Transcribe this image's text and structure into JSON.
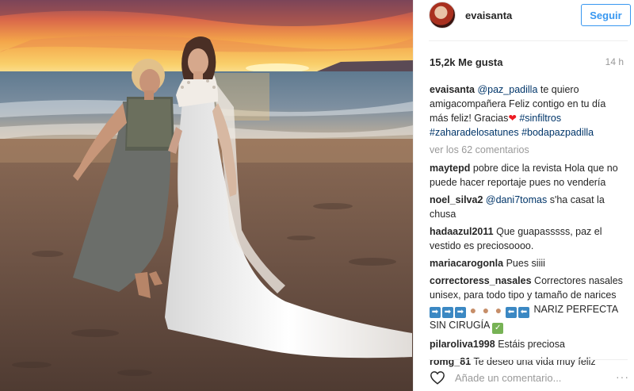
{
  "post": {
    "username": "evaisanta",
    "follow_label": "Seguir",
    "likes": "15,2k Me gusta",
    "time": "14 h",
    "caption": {
      "user": "evaisanta",
      "mention": "@paz_padilla",
      "text1": " te quiero amigacompañera Feliz contigo en tu día más feliz! Gracias",
      "tag1": "#sinfiltros",
      "tag2": "#zaharadelosatunes",
      "tag3": "#bodapazpadilla"
    },
    "view_more": "ver los 62 comentarios",
    "comments": [
      {
        "user": "maytepd",
        "text": "pobre dice la revista Hola que no puede hacer reportaje pues no vendería"
      },
      {
        "user": "noel_silva2",
        "mention": "@dani7tomas",
        "text": " s'ha casat la chusa"
      },
      {
        "user": "hadaazul2011",
        "text": "Que guapasssss, paz el vestido es preciosoooo."
      },
      {
        "user": "mariacarogonla",
        "text": "Pues siiii"
      },
      {
        "user": "correctoress_nasales",
        "text": "Correctores nasales unisex, para todo tipo y tamaño de narices",
        "text2": "NARIZ PERFECTA SIN CIRUGÍA"
      },
      {
        "user": "pilaroliva1998",
        "text": "Estáis preciosa"
      },
      {
        "user": "romg_81",
        "text": "Te deseo una vida muy feliz"
      }
    ],
    "comment_placeholder": "Añade un comentario...",
    "more_options": "···"
  },
  "icons": [
    "heart-icon",
    "more-options-icon",
    "avatar"
  ],
  "colors": {
    "accent": "#3897f0",
    "link": "#003569",
    "muted": "#999999"
  }
}
